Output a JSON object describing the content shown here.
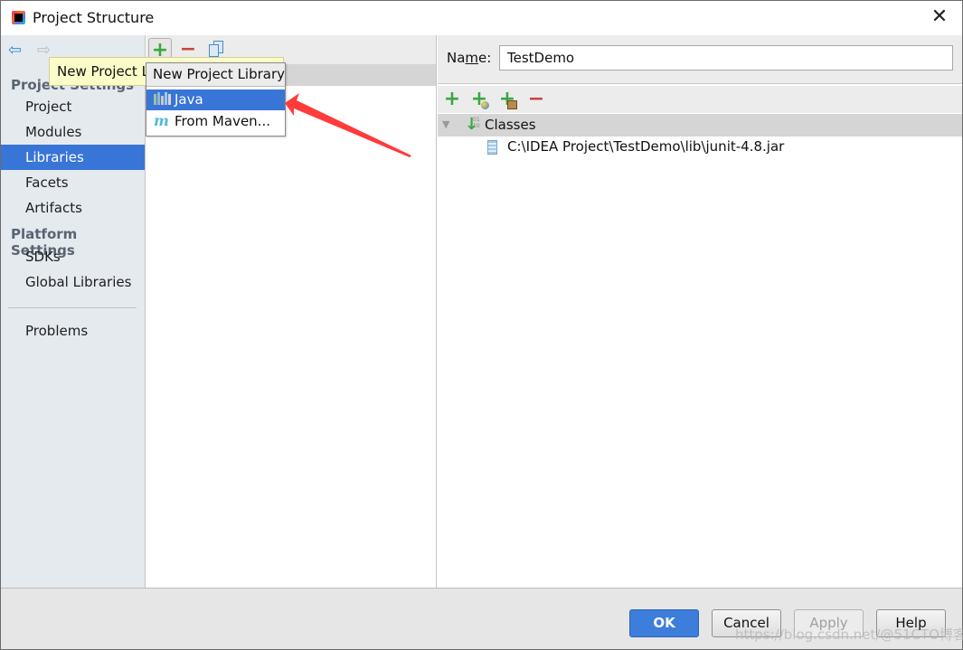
{
  "window": {
    "title": "Project Structure",
    "close_glyph": "✕"
  },
  "sidebar": {
    "back_glyph": "⇦",
    "forward_glyph": "⇨",
    "sections": [
      {
        "header": "Project Settings",
        "items": [
          "Project",
          "Modules",
          "Libraries",
          "Facets",
          "Artifacts"
        ]
      },
      {
        "header": "Platform Settings",
        "items": [
          "SDKs",
          "Global Libraries"
        ]
      }
    ],
    "problems": "Problems",
    "selected": "Libraries"
  },
  "middle": {
    "toolbar": {
      "add_glyph": "+",
      "remove_glyph": "−"
    }
  },
  "tooltip": {
    "text": "New Project Library"
  },
  "popup": {
    "title": "New Project Library",
    "items": [
      {
        "label": "Java",
        "icon": "library-icon",
        "selected": true
      },
      {
        "label": "From Maven...",
        "icon": "maven-icon",
        "icon_glyph": "m",
        "selected": false
      }
    ]
  },
  "annotation": {
    "arrow_color": "#ff3b3b"
  },
  "library": {
    "name_label_prefix": "Na",
    "name_label_mnemonic": "m",
    "name_label_suffix": "e:",
    "name_value": "TestDemo",
    "toolbar": {
      "add_glyph": "+",
      "add_jar_glyph": "+",
      "exclude_glyph": "+",
      "remove_glyph": "−"
    },
    "tree": {
      "toggle_glyph": "▼",
      "classes_label": "Classes",
      "classes_bits": "01\n10",
      "entries": [
        "C:\\IDEA Project\\TestDemo\\lib\\junit-4.8.jar"
      ]
    }
  },
  "footer": {
    "ok": "OK",
    "cancel": "Cancel",
    "apply": "Apply",
    "help": "Help",
    "watermark": "https://blog.csdn.net/@51CTO博客"
  },
  "colors": {
    "selection": "#3875d7",
    "sidebar_bg": "#e5eaef",
    "add_green": "#39a840",
    "remove_red": "#c9433c"
  }
}
